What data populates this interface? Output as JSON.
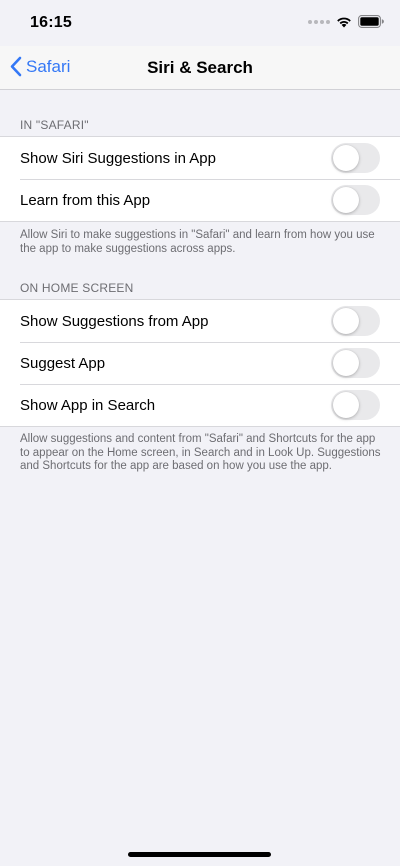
{
  "status_bar": {
    "time": "16:15",
    "icons": [
      "signal-dots-icon",
      "wifi-icon",
      "battery-icon"
    ]
  },
  "nav": {
    "back_label": "Safari",
    "title": "Siri & Search",
    "accent_color": "#3478f6"
  },
  "section_safari": {
    "header": "IN \"SAFARI\"",
    "rows": [
      {
        "label": "Show Siri Suggestions in App",
        "toggle_on": false
      },
      {
        "label": "Learn from this App",
        "toggle_on": false
      }
    ],
    "footer": "Allow Siri to make suggestions in \"Safari\" and learn from how you use the app to make suggestions across apps."
  },
  "section_home": {
    "header": "ON HOME SCREEN",
    "rows": [
      {
        "label": "Show Suggestions from App",
        "toggle_on": false
      },
      {
        "label": "Suggest App",
        "toggle_on": false
      },
      {
        "label": "Show App in Search",
        "toggle_on": false
      }
    ],
    "footer": "Allow suggestions and content from \"Safari\" and Shortcuts for the app to appear on the Home screen, in Search and in Look Up. Suggestions and Shortcuts for the app are based on how you use the app."
  }
}
